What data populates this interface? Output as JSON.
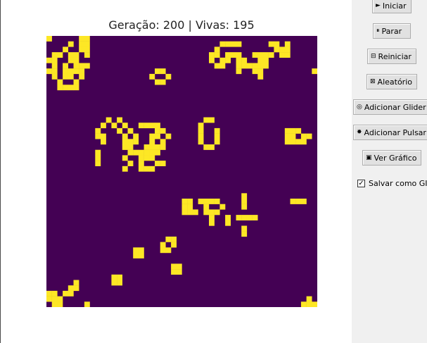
{
  "status": {
    "title": "Geração: 200 | Vivas: 195"
  },
  "grid": {
    "rows": 50,
    "cols": 50,
    "alive_color": "#fde725",
    "dead_color": "#440154",
    "alive": [
      [
        0,
        0
      ],
      [
        0,
        6
      ],
      [
        0,
        7
      ],
      [
        0,
        50
      ],
      [
        1,
        4
      ],
      [
        1,
        6
      ],
      [
        1,
        7
      ],
      [
        1,
        32
      ],
      [
        1,
        33
      ],
      [
        1,
        34
      ],
      [
        1,
        35
      ],
      [
        1,
        41
      ],
      [
        1,
        42
      ],
      [
        1,
        44
      ],
      [
        2,
        3
      ],
      [
        2,
        6
      ],
      [
        2,
        7
      ],
      [
        2,
        31
      ],
      [
        2,
        42
      ],
      [
        2,
        43
      ],
      [
        2,
        44
      ],
      [
        3,
        1
      ],
      [
        3,
        2
      ],
      [
        3,
        4
      ],
      [
        3,
        5
      ],
      [
        3,
        7
      ],
      [
        3,
        30
      ],
      [
        3,
        31
      ],
      [
        3,
        33
      ],
      [
        3,
        34
      ],
      [
        3,
        35
      ],
      [
        3,
        38
      ],
      [
        3,
        39
      ],
      [
        3,
        40
      ],
      [
        3,
        41
      ],
      [
        3,
        43
      ],
      [
        3,
        44
      ],
      [
        4,
        0
      ],
      [
        4,
        1
      ],
      [
        4,
        4
      ],
      [
        4,
        5
      ],
      [
        4,
        30
      ],
      [
        4,
        32
      ],
      [
        4,
        33
      ],
      [
        4,
        35
      ],
      [
        4,
        36
      ],
      [
        4,
        39
      ],
      [
        4,
        40
      ],
      [
        5,
        1
      ],
      [
        5,
        3
      ],
      [
        5,
        5
      ],
      [
        5,
        6
      ],
      [
        5,
        7
      ],
      [
        5,
        31
      ],
      [
        5,
        32
      ],
      [
        5,
        35
      ],
      [
        5,
        36
      ],
      [
        5,
        37
      ],
      [
        5,
        38
      ],
      [
        5,
        39
      ],
      [
        5,
        40
      ],
      [
        6,
        0
      ],
      [
        6,
        1
      ],
      [
        6,
        3
      ],
      [
        6,
        4
      ],
      [
        6,
        5
      ],
      [
        6,
        6
      ],
      [
        6,
        20
      ],
      [
        6,
        21
      ],
      [
        6,
        35
      ],
      [
        6,
        38
      ],
      [
        6,
        39
      ],
      [
        6,
        49
      ],
      [
        7,
        1
      ],
      [
        7,
        3
      ],
      [
        7,
        4
      ],
      [
        7,
        6
      ],
      [
        7,
        19
      ],
      [
        7,
        22
      ],
      [
        7,
        39
      ],
      [
        8,
        2
      ],
      [
        8,
        5
      ],
      [
        8,
        21
      ],
      [
        8,
        20
      ],
      [
        9,
        2
      ],
      [
        9,
        3
      ],
      [
        9,
        4
      ],
      [
        9,
        5
      ],
      [
        15,
        11
      ],
      [
        15,
        13
      ],
      [
        15,
        29
      ],
      [
        15,
        30
      ],
      [
        16,
        10
      ],
      [
        16,
        12
      ],
      [
        16,
        14
      ],
      [
        16,
        17
      ],
      [
        16,
        18
      ],
      [
        16,
        19
      ],
      [
        16,
        20
      ],
      [
        16,
        28
      ],
      [
        17,
        9
      ],
      [
        17,
        13
      ],
      [
        17,
        15
      ],
      [
        17,
        20
      ],
      [
        17,
        21
      ],
      [
        17,
        28
      ],
      [
        17,
        31
      ],
      [
        17,
        44
      ],
      [
        17,
        45
      ],
      [
        17,
        46
      ],
      [
        18,
        9
      ],
      [
        18,
        10
      ],
      [
        18,
        14
      ],
      [
        18,
        16
      ],
      [
        18,
        19
      ],
      [
        18,
        20
      ],
      [
        18,
        22
      ],
      [
        18,
        28
      ],
      [
        18,
        31
      ],
      [
        18,
        44
      ],
      [
        18,
        45
      ],
      [
        18,
        47
      ],
      [
        18,
        48
      ],
      [
        19,
        10
      ],
      [
        19,
        14
      ],
      [
        19,
        15
      ],
      [
        19,
        16
      ],
      [
        19,
        19
      ],
      [
        19,
        21
      ],
      [
        19,
        28
      ],
      [
        19,
        31
      ],
      [
        19,
        44
      ],
      [
        19,
        45
      ],
      [
        19,
        46
      ],
      [
        19,
        47
      ],
      [
        20,
        14
      ],
      [
        20,
        15
      ],
      [
        20,
        18
      ],
      [
        20,
        19
      ],
      [
        20,
        20
      ],
      [
        20,
        21
      ],
      [
        20,
        29
      ],
      [
        20,
        30
      ],
      [
        21,
        9
      ],
      [
        21,
        15
      ],
      [
        21,
        16
      ],
      [
        21,
        17
      ],
      [
        21,
        18
      ],
      [
        21,
        19
      ],
      [
        21,
        20
      ],
      [
        22,
        9
      ],
      [
        22,
        14
      ],
      [
        22,
        17
      ],
      [
        22,
        18
      ],
      [
        22,
        19
      ],
      [
        23,
        9
      ],
      [
        23,
        15
      ],
      [
        23,
        17
      ],
      [
        23,
        20
      ],
      [
        23,
        21
      ],
      [
        24,
        14
      ],
      [
        24,
        19
      ],
      [
        24,
        18
      ],
      [
        24,
        17
      ],
      [
        29,
        36
      ],
      [
        30,
        25
      ],
      [
        30,
        26
      ],
      [
        30,
        28
      ],
      [
        30,
        29
      ],
      [
        30,
        30
      ],
      [
        30,
        31
      ],
      [
        30,
        36
      ],
      [
        30,
        45
      ],
      [
        30,
        46
      ],
      [
        30,
        47
      ],
      [
        31,
        25
      ],
      [
        31,
        26
      ],
      [
        31,
        29
      ],
      [
        31,
        32
      ],
      [
        31,
        36
      ],
      [
        32,
        25
      ],
      [
        32,
        26
      ],
      [
        32,
        27
      ],
      [
        32,
        29
      ],
      [
        32,
        30
      ],
      [
        32,
        31
      ],
      [
        33,
        30
      ],
      [
        33,
        33
      ],
      [
        33,
        35
      ],
      [
        33,
        36
      ],
      [
        33,
        37
      ],
      [
        33,
        38
      ],
      [
        34,
        30
      ],
      [
        34,
        33
      ],
      [
        35,
        36
      ],
      [
        36,
        36
      ],
      [
        37,
        22
      ],
      [
        37,
        23
      ],
      [
        38,
        21
      ],
      [
        38,
        23
      ],
      [
        39,
        16
      ],
      [
        39,
        17
      ],
      [
        39,
        21
      ],
      [
        39,
        22
      ],
      [
        40,
        16
      ],
      [
        40,
        17
      ],
      [
        42,
        23
      ],
      [
        42,
        24
      ],
      [
        43,
        23
      ],
      [
        43,
        24
      ],
      [
        44,
        12
      ],
      [
        44,
        13
      ],
      [
        45,
        12
      ],
      [
        45,
        13
      ],
      [
        45,
        5
      ],
      [
        46,
        4
      ],
      [
        46,
        5
      ],
      [
        47,
        0
      ],
      [
        47,
        1
      ],
      [
        47,
        3
      ],
      [
        47,
        4
      ],
      [
        48,
        0
      ],
      [
        48,
        1
      ],
      [
        48,
        2
      ],
      [
        48,
        48
      ],
      [
        49,
        1
      ],
      [
        49,
        2
      ],
      [
        49,
        7
      ],
      [
        49,
        48
      ],
      [
        49,
        49
      ],
      [
        49,
        47
      ]
    ]
  },
  "controls": {
    "start": "Iniciar",
    "pause": "Parar",
    "reset": "Reiniciar",
    "random": "Aleatório",
    "glider": "Adicionar Glider",
    "pulsar": "Adicionar Pulsar",
    "graph": "Ver Gráfico",
    "gif_label": "Salvar como GIF",
    "gif_checked": true
  },
  "icons": {
    "start": "►",
    "pause": "⏸",
    "reset": "⊟",
    "random": "⊠",
    "glider": "◎",
    "pulsar": "✸",
    "graph": "▣",
    "check": "✓"
  }
}
